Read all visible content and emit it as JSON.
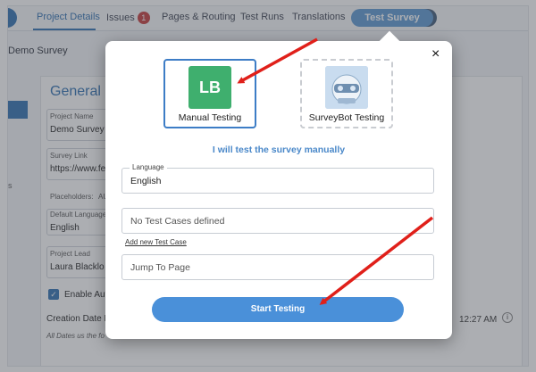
{
  "nav": {
    "tabs": [
      "Project Details",
      "Issues",
      "Pages & Routing",
      "Test Runs",
      "Translations"
    ],
    "issues_count": "1",
    "active_pill": "Test Survey"
  },
  "subheader": "Demo Survey",
  "background_form": {
    "title": "General Pr",
    "project_name_label": "Project Name",
    "project_name": "Demo Survey",
    "survey_link_label": "Survey Link",
    "survey_link": "https://www.fe",
    "placeholders_label": "Placeholders:",
    "placeholders_value": "AU",
    "default_language_label": "Default Language",
    "default_language": "English",
    "project_lead_label": "Project Lead",
    "project_lead": "Laura Blacklo",
    "enable_label": "Enable Aut",
    "creation_date_label": "Creation Date D",
    "dates_note": "All Dates us the fo",
    "time_fragment": "12:27 AM",
    "side_letter": "s"
  },
  "modal": {
    "close_symbol": "×",
    "options": [
      {
        "label": "Manual Testing",
        "icon_text": "LB",
        "icon": "lb-logo-icon"
      },
      {
        "label": "SurveyBot Testing",
        "icon": "surveybot-robot-icon"
      }
    ],
    "manual_text": "I will test the survey manually",
    "language_label": "Language",
    "language_value": "English",
    "test_cases_placeholder": "No Test Cases defined",
    "add_test_case_link": "Add new Test Case",
    "jump_to_page_placeholder": "Jump To Page",
    "start_button": "Start Testing"
  },
  "colors": {
    "accent": "#2f6fb1",
    "start_button": "#4a90d9",
    "lb_icon": "#3faf6e",
    "arrow": "#e0201a"
  }
}
